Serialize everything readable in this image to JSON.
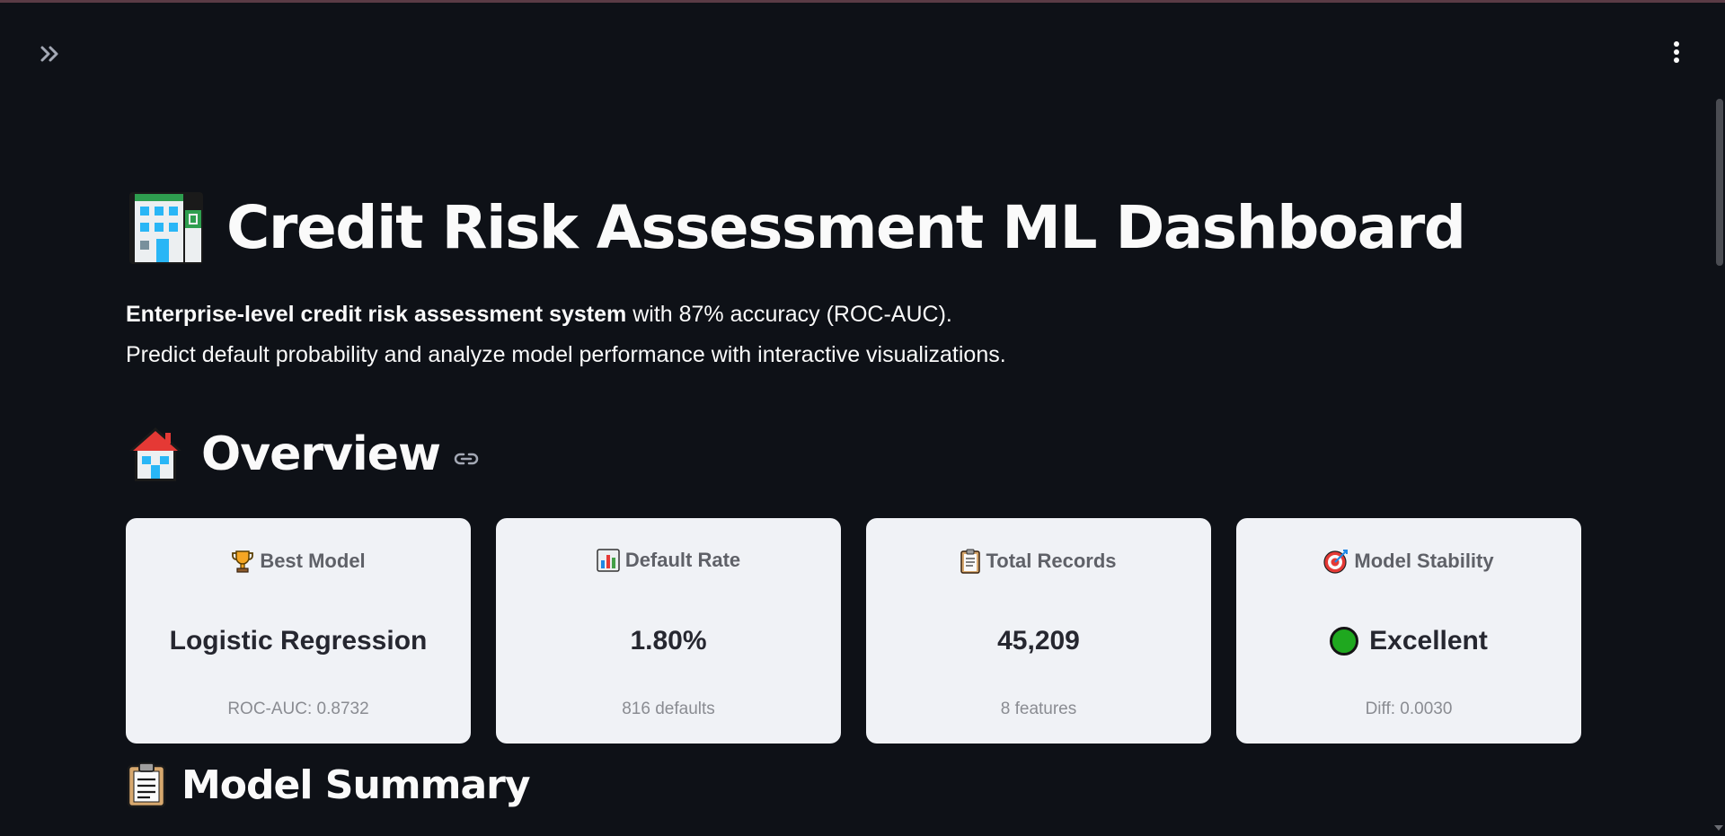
{
  "header": {
    "expand_icon": "double-chevron-right-icon",
    "menu_icon": "vertical-ellipsis-icon"
  },
  "page": {
    "title_icon": "office-building-emoji",
    "title": "Credit Risk Assessment ML Dashboard",
    "intro_bold": "Enterprise-level credit risk assessment system",
    "intro_rest": " with 87% accuracy (ROC-AUC).",
    "intro_line2": "Predict default probability and analyze model performance with interactive visualizations."
  },
  "overview": {
    "icon": "house-emoji",
    "title": "Overview",
    "anchor_icon": "link-icon"
  },
  "cards": [
    {
      "icon": "trophy-emoji",
      "label": "Best Model",
      "value": "Logistic Regression",
      "sub": "ROC-AUC: 0.8732"
    },
    {
      "icon": "bar-chart-emoji",
      "label": "Default Rate",
      "value": "1.80%",
      "sub": "816 defaults"
    },
    {
      "icon": "clipboard-emoji",
      "label": "Total Records",
      "value": "45,209",
      "sub": "8 features"
    },
    {
      "icon": "direct-hit-emoji",
      "label": "Model Stability",
      "value": "Excellent",
      "sub": "Diff: 0.0030",
      "status_color": "#1fa81f"
    }
  ],
  "model_summary": {
    "icon": "clipboard-emoji",
    "title": "Model Summary"
  },
  "colors": {
    "background": "#0e1117",
    "card_background": "#f0f2f6",
    "text": "#fafafa",
    "card_text": "#262730"
  }
}
